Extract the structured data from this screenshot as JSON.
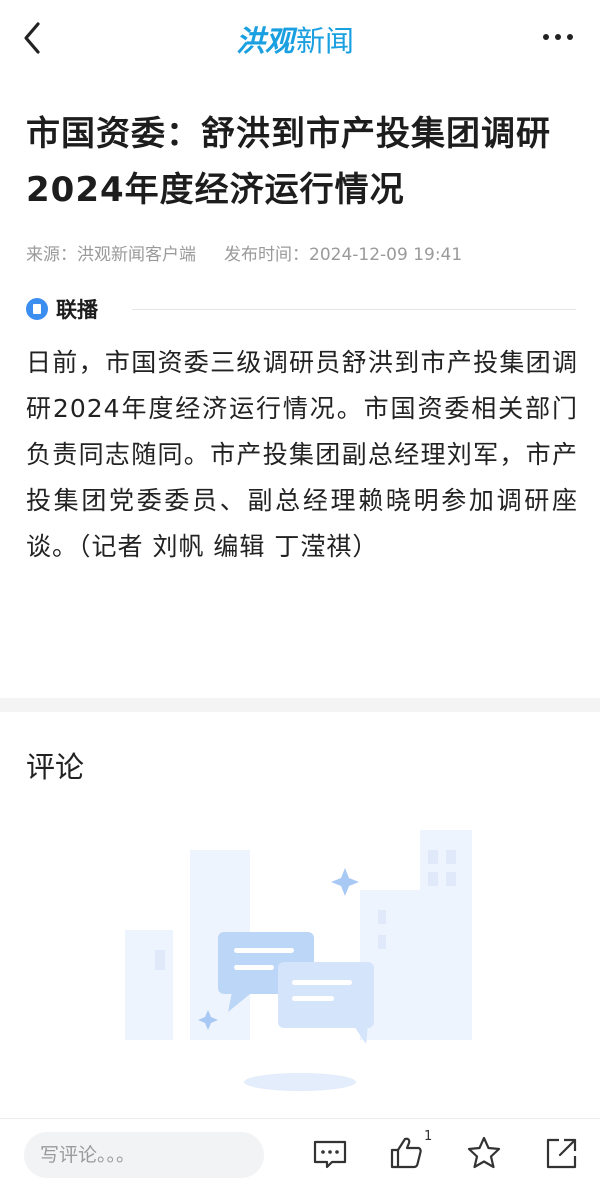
{
  "header": {
    "logo_brand": "洪观",
    "logo_rest": "新闻"
  },
  "article": {
    "title": "市国资委：舒洪到市产投集团调研2024年度经济运行情况",
    "source_label": "来源：洪观新闻客户端",
    "time_label": "发布时间：2024-12-09 19:41",
    "section": "联播",
    "body": "日前，市国资委三级调研员舒洪到市产投集团调研2024年度经济运行情况。市国资委相关部门负责同志随同。市产投集团副总经理刘军，市产投集团党委委员、副总经理赖晓明参加调研座谈。（记者 刘帆 编辑 丁滢祺）"
  },
  "comments": {
    "title": "评论"
  },
  "bottom_bar": {
    "input_placeholder": "写评论。。。",
    "like_count": "1"
  },
  "colors": {
    "brand": "#1aa0e0",
    "tag_icon": "#3c8df0",
    "illustration": "#bcd6f7"
  }
}
